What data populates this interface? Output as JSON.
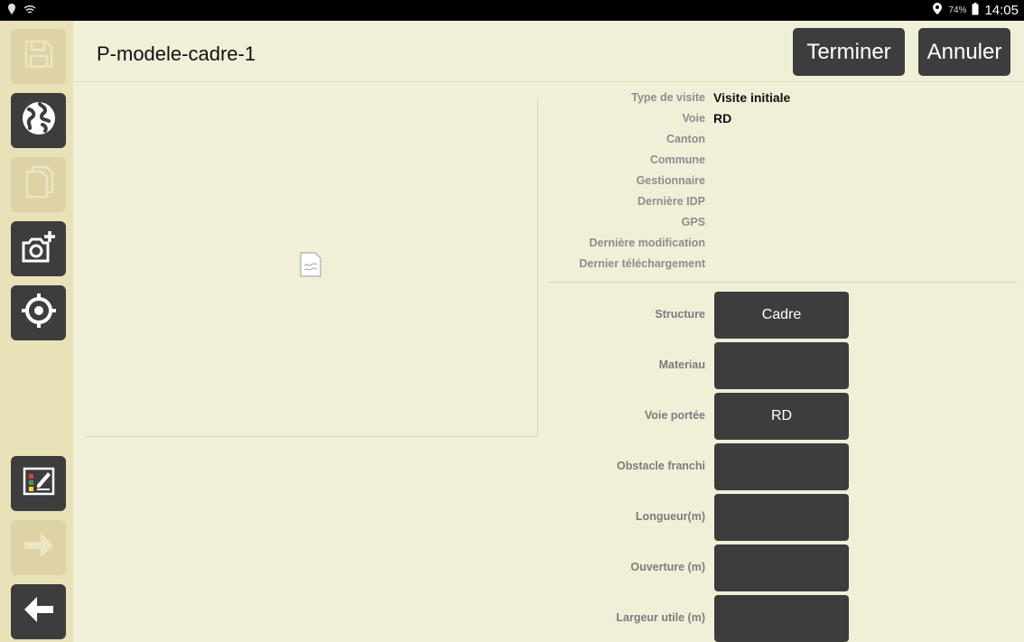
{
  "status_bar": {
    "battery": "74%",
    "clock": "14:05"
  },
  "header": {
    "title": "P-modele-cadre-1",
    "finish_label": "Terminer",
    "cancel_label": "Annuler"
  },
  "info": [
    {
      "label": "Type de visite",
      "value": "Visite initiale"
    },
    {
      "label": "Voie",
      "value": "RD"
    },
    {
      "label": "Canton",
      "value": ""
    },
    {
      "label": "Commune",
      "value": ""
    },
    {
      "label": "Gestionnaire",
      "value": ""
    },
    {
      "label": "Dernière IDP",
      "value": ""
    },
    {
      "label": "GPS",
      "value": ""
    },
    {
      "label": "Dernière modification",
      "value": ""
    },
    {
      "label": "Dernier téléchargement",
      "value": ""
    }
  ],
  "fields": [
    {
      "label": "Structure",
      "value": "Cadre"
    },
    {
      "label": "Materiau",
      "value": ""
    },
    {
      "label": "Voie portée",
      "value": "RD"
    },
    {
      "label": "Obstacle franchi",
      "value": ""
    },
    {
      "label": "Longueur(m)",
      "value": ""
    },
    {
      "label": "Ouverture (m)",
      "value": ""
    },
    {
      "label": "Largeur utile (m)",
      "value": ""
    }
  ],
  "colors": {
    "background": "#f2efd9",
    "sidebar": "#e9e2b8",
    "button": "#3d3d3d",
    "disabled_button": "#ddd3a6"
  },
  "icons": {
    "save": "save-icon",
    "globe": "globe-icon",
    "copy": "copy-icon",
    "add_photo": "add-photo-icon",
    "locate": "target-icon",
    "edit_form": "edit-form-icon",
    "next": "arrow-right-icon",
    "back": "arrow-left-icon"
  }
}
